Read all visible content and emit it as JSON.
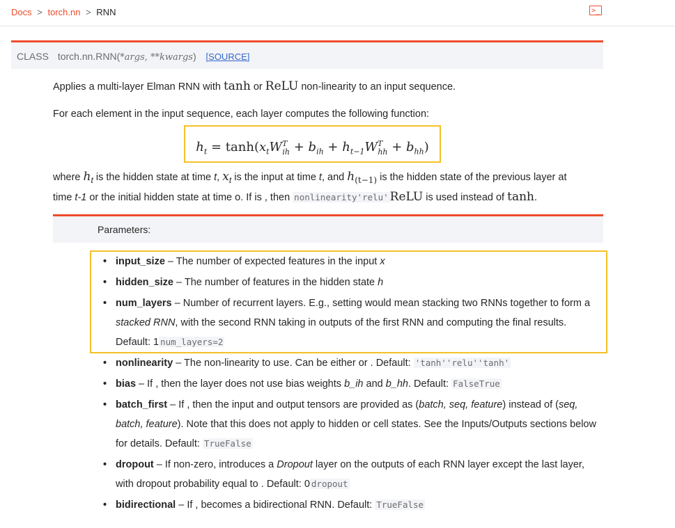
{
  "breadcrumb": {
    "docs": "Docs",
    "sep1": ">",
    "torchnn": "torch.nn",
    "sep2": ">",
    "current": "RNN"
  },
  "toolbar": {
    "shell_glyph": ">_"
  },
  "signature": {
    "cls": "CLASS",
    "name": "torch.nn.RNN(",
    "args": "*args, **kwargs",
    "close": ")",
    "source": "[SOURCE]"
  },
  "intro": {
    "p1_pre": "Applies a multi-layer Elman RNN with ",
    "p1_tanh": "tanh",
    "p1_mid": " or ",
    "p1_relu": "ReLU",
    "p1_post": " non-linearity to an input sequence.",
    "p2": "For each element in the input sequence, each layer computes the following function:"
  },
  "equation": {
    "lhs": "h",
    "lhs_sub": "t",
    "eq": " = tanh(",
    "x": "x",
    "x_sub": "t",
    "W1": "W",
    "W1_sup": "T",
    "W1_sub": "ih",
    "plus1": " + ",
    "b1": "b",
    "b1_sub": "ih",
    "plus2": " + ",
    "h2": "h",
    "h2_sub": "t−1",
    "W2": "W",
    "W2_sup": "T",
    "W2_sub": "hh",
    "plus3": " + ",
    "b2": "b",
    "b2_sub": "hh",
    "close": ")"
  },
  "where": {
    "w1": "where ",
    "ht": "h",
    "ht_sub": "t",
    "w2": " is the hidden state at time ",
    "t1": "t",
    "w3": ", ",
    "xt": "x",
    "xt_sub": "t",
    "w4": " is the input at time ",
    "t2": "t",
    "w5": ", and ",
    "hprev": "h",
    "hprev_sub": "(t−1)",
    "w6": " is the hidden state of the previous layer at",
    "w7": "time ",
    "t3": "t-1",
    "w8": " or the initial hidden state at time ",
    "zero": "o",
    "w9": ". If is , then ",
    "code1": "nonlinearity'relu'",
    "relu": "ReLU",
    "w10": " is used instead of ",
    "tanh": "tanh",
    "w11": "."
  },
  "params_heading": "Parameters:",
  "params": [
    {
      "name": "input_size",
      "desc": " – The number of expected features in the input ",
      "em": "x"
    },
    {
      "name": "hidden_size",
      "desc": " – The number of features in the hidden state ",
      "em": "h"
    },
    {
      "name": "num_layers",
      "desc": " – Number of recurrent layers. E.g., setting would mean stacking two RNNs together to form a ",
      "em": "stacked RNN",
      "desc2": ", with the second RNN taking in outputs of the first RNN and computing the final results. Default: 1",
      "code": "num_layers=2"
    },
    {
      "name": "nonlinearity",
      "desc": " – The non-linearity to use. Can be either or . Default: ",
      "code": "'tanh''relu''tanh'"
    },
    {
      "name": "bias",
      "desc": " – If , then the layer does not use bias weights ",
      "em": "b_ih",
      "desc2": " and ",
      "em2": "b_hh",
      "desc3": ". Default: ",
      "code": "FalseTrue"
    },
    {
      "name": "batch_first",
      "desc": " – If , then the input and output tensors are provided as (",
      "em": "batch, seq, feature",
      "desc2": ") instead of (",
      "em2": "seq, batch, feature",
      "desc3": "). Note that this does not apply to hidden or cell states. See the Inputs/Outputs sections below for details. Default: ",
      "code": "TrueFalse"
    },
    {
      "name": "dropout",
      "desc": " – If non-zero, introduces a ",
      "em": "Dropout",
      "desc2": " layer on the outputs of each RNN layer except the last layer, with dropout probability equal to . Default: 0",
      "code": "dropout"
    },
    {
      "name": "bidirectional",
      "desc": " – If , becomes a bidirectional RNN. Default: ",
      "code": "TrueFalse"
    }
  ]
}
